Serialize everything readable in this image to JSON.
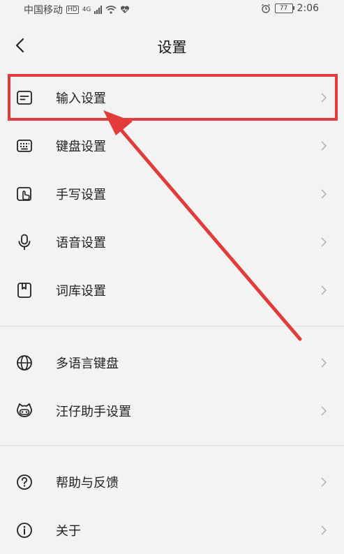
{
  "status_bar": {
    "carrier": "中国移动",
    "hd_badge": "HD",
    "network": "4G",
    "battery": "77",
    "time": "2:06"
  },
  "header": {
    "title": "设置"
  },
  "groups": [
    {
      "items": [
        {
          "label": "输入设置",
          "icon": "input-settings-icon"
        },
        {
          "label": "键盘设置",
          "icon": "keyboard-icon"
        },
        {
          "label": "手写设置",
          "icon": "handwriting-icon"
        },
        {
          "label": "语音设置",
          "icon": "microphone-icon"
        },
        {
          "label": "词库设置",
          "icon": "dictionary-icon"
        }
      ]
    },
    {
      "items": [
        {
          "label": "多语言键盘",
          "icon": "globe-icon"
        },
        {
          "label": "汪仔助手设置",
          "icon": "assistant-mascot-icon"
        }
      ]
    },
    {
      "items": [
        {
          "label": "帮助与反馈",
          "icon": "help-icon"
        },
        {
          "label": "关于",
          "icon": "info-icon"
        }
      ]
    }
  ],
  "annotation": {
    "highlight_color": "#e23b3b"
  }
}
